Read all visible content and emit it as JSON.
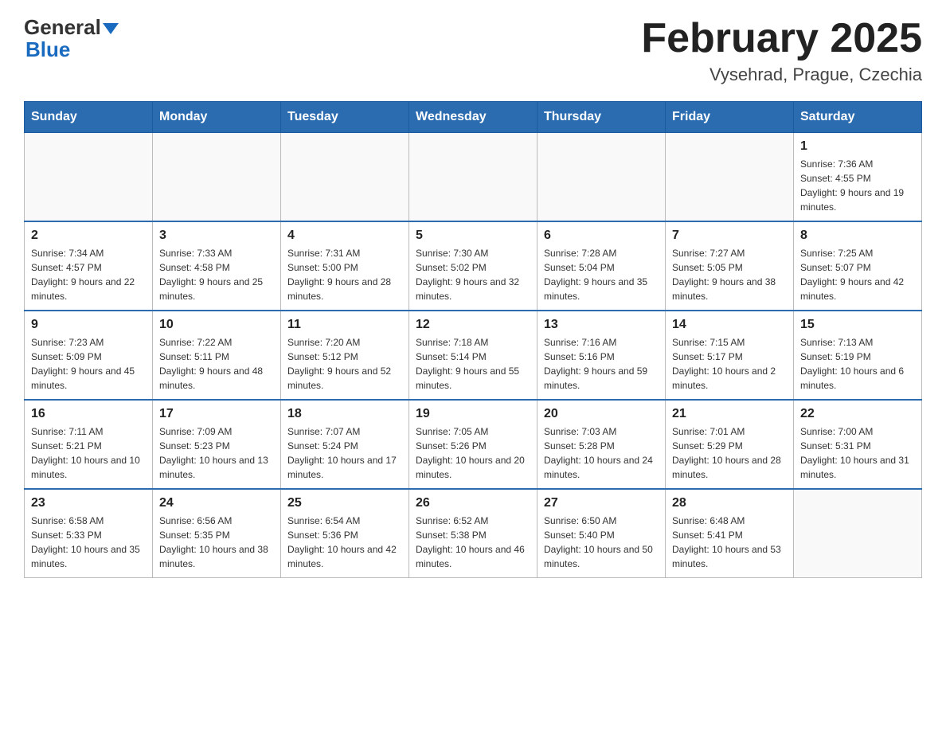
{
  "header": {
    "logo_line1": "General",
    "logo_line2": "Blue",
    "title": "February 2025",
    "subtitle": "Vysehrad, Prague, Czechia"
  },
  "calendar": {
    "days_of_week": [
      "Sunday",
      "Monday",
      "Tuesday",
      "Wednesday",
      "Thursday",
      "Friday",
      "Saturday"
    ],
    "weeks": [
      [
        {
          "day": "",
          "info": ""
        },
        {
          "day": "",
          "info": ""
        },
        {
          "day": "",
          "info": ""
        },
        {
          "day": "",
          "info": ""
        },
        {
          "day": "",
          "info": ""
        },
        {
          "day": "",
          "info": ""
        },
        {
          "day": "1",
          "info": "Sunrise: 7:36 AM\nSunset: 4:55 PM\nDaylight: 9 hours and 19 minutes."
        }
      ],
      [
        {
          "day": "2",
          "info": "Sunrise: 7:34 AM\nSunset: 4:57 PM\nDaylight: 9 hours and 22 minutes."
        },
        {
          "day": "3",
          "info": "Sunrise: 7:33 AM\nSunset: 4:58 PM\nDaylight: 9 hours and 25 minutes."
        },
        {
          "day": "4",
          "info": "Sunrise: 7:31 AM\nSunset: 5:00 PM\nDaylight: 9 hours and 28 minutes."
        },
        {
          "day": "5",
          "info": "Sunrise: 7:30 AM\nSunset: 5:02 PM\nDaylight: 9 hours and 32 minutes."
        },
        {
          "day": "6",
          "info": "Sunrise: 7:28 AM\nSunset: 5:04 PM\nDaylight: 9 hours and 35 minutes."
        },
        {
          "day": "7",
          "info": "Sunrise: 7:27 AM\nSunset: 5:05 PM\nDaylight: 9 hours and 38 minutes."
        },
        {
          "day": "8",
          "info": "Sunrise: 7:25 AM\nSunset: 5:07 PM\nDaylight: 9 hours and 42 minutes."
        }
      ],
      [
        {
          "day": "9",
          "info": "Sunrise: 7:23 AM\nSunset: 5:09 PM\nDaylight: 9 hours and 45 minutes."
        },
        {
          "day": "10",
          "info": "Sunrise: 7:22 AM\nSunset: 5:11 PM\nDaylight: 9 hours and 48 minutes."
        },
        {
          "day": "11",
          "info": "Sunrise: 7:20 AM\nSunset: 5:12 PM\nDaylight: 9 hours and 52 minutes."
        },
        {
          "day": "12",
          "info": "Sunrise: 7:18 AM\nSunset: 5:14 PM\nDaylight: 9 hours and 55 minutes."
        },
        {
          "day": "13",
          "info": "Sunrise: 7:16 AM\nSunset: 5:16 PM\nDaylight: 9 hours and 59 minutes."
        },
        {
          "day": "14",
          "info": "Sunrise: 7:15 AM\nSunset: 5:17 PM\nDaylight: 10 hours and 2 minutes."
        },
        {
          "day": "15",
          "info": "Sunrise: 7:13 AM\nSunset: 5:19 PM\nDaylight: 10 hours and 6 minutes."
        }
      ],
      [
        {
          "day": "16",
          "info": "Sunrise: 7:11 AM\nSunset: 5:21 PM\nDaylight: 10 hours and 10 minutes."
        },
        {
          "day": "17",
          "info": "Sunrise: 7:09 AM\nSunset: 5:23 PM\nDaylight: 10 hours and 13 minutes."
        },
        {
          "day": "18",
          "info": "Sunrise: 7:07 AM\nSunset: 5:24 PM\nDaylight: 10 hours and 17 minutes."
        },
        {
          "day": "19",
          "info": "Sunrise: 7:05 AM\nSunset: 5:26 PM\nDaylight: 10 hours and 20 minutes."
        },
        {
          "day": "20",
          "info": "Sunrise: 7:03 AM\nSunset: 5:28 PM\nDaylight: 10 hours and 24 minutes."
        },
        {
          "day": "21",
          "info": "Sunrise: 7:01 AM\nSunset: 5:29 PM\nDaylight: 10 hours and 28 minutes."
        },
        {
          "day": "22",
          "info": "Sunrise: 7:00 AM\nSunset: 5:31 PM\nDaylight: 10 hours and 31 minutes."
        }
      ],
      [
        {
          "day": "23",
          "info": "Sunrise: 6:58 AM\nSunset: 5:33 PM\nDaylight: 10 hours and 35 minutes."
        },
        {
          "day": "24",
          "info": "Sunrise: 6:56 AM\nSunset: 5:35 PM\nDaylight: 10 hours and 38 minutes."
        },
        {
          "day": "25",
          "info": "Sunrise: 6:54 AM\nSunset: 5:36 PM\nDaylight: 10 hours and 42 minutes."
        },
        {
          "day": "26",
          "info": "Sunrise: 6:52 AM\nSunset: 5:38 PM\nDaylight: 10 hours and 46 minutes."
        },
        {
          "day": "27",
          "info": "Sunrise: 6:50 AM\nSunset: 5:40 PM\nDaylight: 10 hours and 50 minutes."
        },
        {
          "day": "28",
          "info": "Sunrise: 6:48 AM\nSunset: 5:41 PM\nDaylight: 10 hours and 53 minutes."
        },
        {
          "day": "",
          "info": ""
        }
      ]
    ]
  }
}
